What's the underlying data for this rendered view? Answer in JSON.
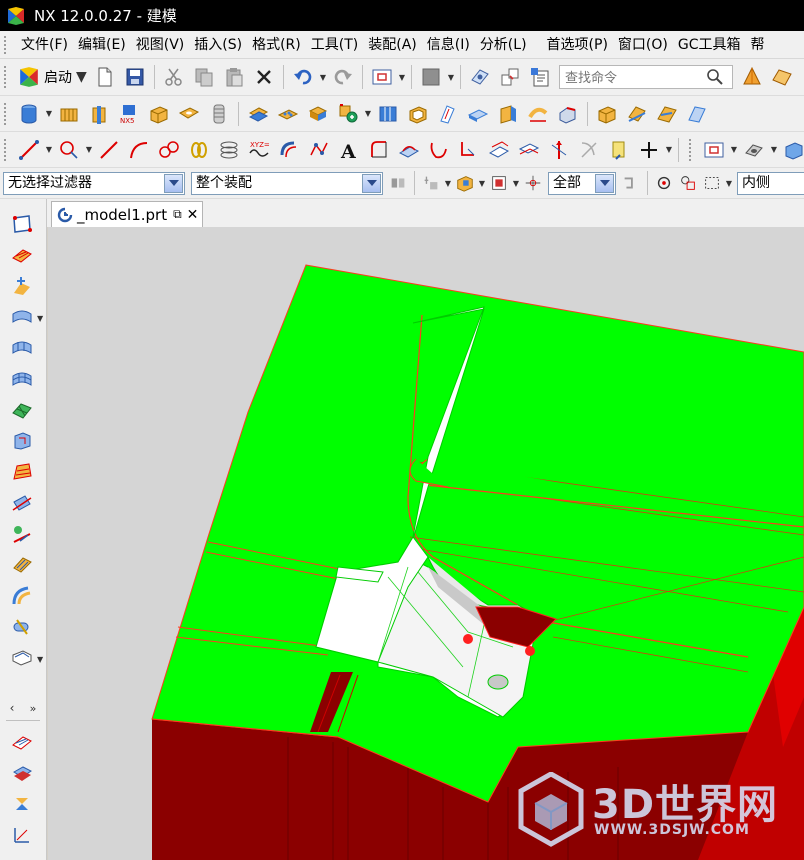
{
  "app": {
    "title": "NX 12.0.0.27 - 建模"
  },
  "menu": {
    "items": [
      "文件(F)",
      "编辑(E)",
      "视图(V)",
      "插入(S)",
      "格式(R)",
      "工具(T)",
      "装配(A)",
      "信息(I)",
      "分析(L)",
      "首选项(P)",
      "窗口(O)",
      "GC工具箱",
      "帮"
    ]
  },
  "toolbar": {
    "start_label": "启动",
    "search_placeholder": "查找命令"
  },
  "selection_bar": {
    "filter": "无选择过滤器",
    "scope": "整个装配",
    "scope2": "全部",
    "scope3": "内侧"
  },
  "document_tab": {
    "label": "_model1.prt",
    "dirty_mark": "⧉"
  },
  "viewport": {
    "model_colors": {
      "face": "#00ff00",
      "side": "#8b0000",
      "side_bright": "#d40000",
      "pocket": "#ffffff",
      "background": "#d5d5d5"
    }
  },
  "watermark": {
    "brand": "3D世界网",
    "url": "WWW.3DSJW.COM"
  }
}
